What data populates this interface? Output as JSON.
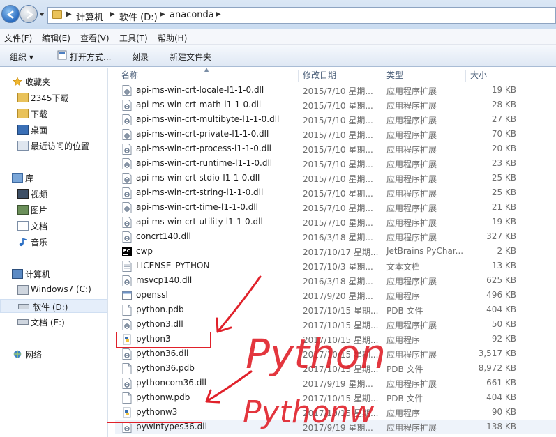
{
  "address": {
    "crumbs": [
      "计算机",
      "软件 (D:)",
      "anaconda"
    ]
  },
  "menu": [
    "文件(F)",
    "编辑(E)",
    "查看(V)",
    "工具(T)",
    "帮助(H)"
  ],
  "toolbar": {
    "organize": "组织 ▾",
    "open_with": "打开方式...",
    "burn": "刻录",
    "new_folder": "新建文件夹"
  },
  "sidebar": {
    "favorites": {
      "label": "收藏夹",
      "items": [
        "2345下载",
        "下载",
        "桌面",
        "最近访问的位置"
      ]
    },
    "libraries": {
      "label": "库",
      "items": [
        "视频",
        "图片",
        "文档",
        "音乐"
      ]
    },
    "computer": {
      "label": "计算机",
      "items": [
        "Windows7 (C:)",
        "软件 (D:)",
        "文档 (E:)"
      ]
    },
    "network": {
      "label": "网络"
    }
  },
  "columns": {
    "name": "名称",
    "date": "修改日期",
    "type": "类型",
    "size": "大小"
  },
  "files": [
    {
      "name": "api-ms-win-crt-locale-l1-1-0.dll",
      "date": "2015/7/10 星期...",
      "type": "应用程序扩展",
      "size": "19 KB",
      "icon": "dll-icon"
    },
    {
      "name": "api-ms-win-crt-math-l1-1-0.dll",
      "date": "2015/7/10 星期...",
      "type": "应用程序扩展",
      "size": "28 KB",
      "icon": "dll-icon"
    },
    {
      "name": "api-ms-win-crt-multibyte-l1-1-0.dll",
      "date": "2015/7/10 星期...",
      "type": "应用程序扩展",
      "size": "27 KB",
      "icon": "dll-icon"
    },
    {
      "name": "api-ms-win-crt-private-l1-1-0.dll",
      "date": "2015/7/10 星期...",
      "type": "应用程序扩展",
      "size": "70 KB",
      "icon": "dll-icon"
    },
    {
      "name": "api-ms-win-crt-process-l1-1-0.dll",
      "date": "2015/7/10 星期...",
      "type": "应用程序扩展",
      "size": "20 KB",
      "icon": "dll-icon"
    },
    {
      "name": "api-ms-win-crt-runtime-l1-1-0.dll",
      "date": "2015/7/10 星期...",
      "type": "应用程序扩展",
      "size": "23 KB",
      "icon": "dll-icon"
    },
    {
      "name": "api-ms-win-crt-stdio-l1-1-0.dll",
      "date": "2015/7/10 星期...",
      "type": "应用程序扩展",
      "size": "25 KB",
      "icon": "dll-icon"
    },
    {
      "name": "api-ms-win-crt-string-l1-1-0.dll",
      "date": "2015/7/10 星期...",
      "type": "应用程序扩展",
      "size": "25 KB",
      "icon": "dll-icon"
    },
    {
      "name": "api-ms-win-crt-time-l1-1-0.dll",
      "date": "2015/7/10 星期...",
      "type": "应用程序扩展",
      "size": "21 KB",
      "icon": "dll-icon"
    },
    {
      "name": "api-ms-win-crt-utility-l1-1-0.dll",
      "date": "2015/7/10 星期...",
      "type": "应用程序扩展",
      "size": "19 KB",
      "icon": "dll-icon"
    },
    {
      "name": "concrt140.dll",
      "date": "2016/3/18 星期...",
      "type": "应用程序扩展",
      "size": "327 KB",
      "icon": "dll-icon"
    },
    {
      "name": "cwp",
      "date": "2017/10/17 星期...",
      "type": "JetBrains PyChar...",
      "size": "2 KB",
      "icon": "pycharm-icon"
    },
    {
      "name": "LICENSE_PYTHON",
      "date": "2017/10/3 星期...",
      "type": "文本文档",
      "size": "13 KB",
      "icon": "text-file-icon"
    },
    {
      "name": "msvcp140.dll",
      "date": "2016/3/18 星期...",
      "type": "应用程序扩展",
      "size": "625 KB",
      "icon": "dll-icon"
    },
    {
      "name": "openssl",
      "date": "2017/9/20 星期...",
      "type": "应用程序",
      "size": "496 KB",
      "icon": "exe-icon"
    },
    {
      "name": "python.pdb",
      "date": "2017/10/15 星期...",
      "type": "PDB 文件",
      "size": "404 KB",
      "icon": "blank-file-icon"
    },
    {
      "name": "python3.dll",
      "date": "2017/10/15 星期...",
      "type": "应用程序扩展",
      "size": "50 KB",
      "icon": "dll-icon"
    },
    {
      "name": "python3",
      "date": "2017/10/15 星期...",
      "type": "应用程序",
      "size": "92 KB",
      "icon": "python-icon"
    },
    {
      "name": "python36.dll",
      "date": "2017/10/15 星期...",
      "type": "应用程序扩展",
      "size": "3,517 KB",
      "icon": "dll-icon"
    },
    {
      "name": "python36.pdb",
      "date": "2017/10/15 星期...",
      "type": "PDB 文件",
      "size": "8,972 KB",
      "icon": "blank-file-icon"
    },
    {
      "name": "pythoncom36.dll",
      "date": "2017/9/19 星期...",
      "type": "应用程序扩展",
      "size": "661 KB",
      "icon": "dll-icon"
    },
    {
      "name": "pythonw.pdb",
      "date": "2017/10/15 星期...",
      "type": "PDB 文件",
      "size": "404 KB",
      "icon": "blank-file-icon"
    },
    {
      "name": "pythonw3",
      "date": "2017/10/15 星期...",
      "type": "应用程序",
      "size": "90 KB",
      "icon": "python-icon"
    },
    {
      "name": "pywintypes36.dll",
      "date": "2017/9/19 星期...",
      "type": "应用程序扩展",
      "size": "138 KB",
      "icon": "dll-icon"
    }
  ],
  "annotations": {
    "text1": "Python",
    "text2": "Pythonw",
    "color": "#e0212a"
  }
}
